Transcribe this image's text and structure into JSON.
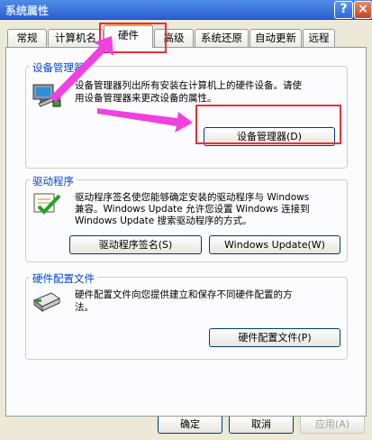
{
  "window": {
    "title": "系统属性",
    "help_glyph": "?",
    "close_glyph": "×"
  },
  "tabs": [
    {
      "label": "常规",
      "active": false
    },
    {
      "label": "计算机名",
      "active": false
    },
    {
      "label": "硬件",
      "active": true
    },
    {
      "label": "高级",
      "active": false
    },
    {
      "label": "系统还原",
      "active": false
    },
    {
      "label": "自动更新",
      "active": false
    },
    {
      "label": "远程",
      "active": false
    }
  ],
  "device_manager": {
    "heading": "设备管理器",
    "desc_line1": "设备管理器列出所有安装在计算机上的硬件设备。请使",
    "desc_line2": "用设备管理器来更改设备的属性。",
    "button": "设备管理器(D)"
  },
  "drivers": {
    "heading": "驱动程序",
    "desc_line1": "驱动程序签名使您能够确定安装的驱动程序与 Windows",
    "desc_line2": "兼容。Windows Update 允许您设置 Windows 连接到",
    "desc_line3": "Windows Update 搜索驱动程序的方式。",
    "signing_button": "驱动程序签名(S)",
    "update_button": "Windows Update(W)"
  },
  "hardware_profiles": {
    "heading": "硬件配置文件",
    "desc_line1": "硬件配置文件向您提供建立和保存不同硬件配置的方",
    "desc_line2": "法。",
    "button": "硬件配置文件(P)"
  },
  "footer": {
    "ok": "确定",
    "cancel": "取消",
    "apply": "应用(A)"
  },
  "colors": {
    "highlight": "#e8303a",
    "arrow": "#f040e0",
    "group_heading": "#0046d5"
  }
}
